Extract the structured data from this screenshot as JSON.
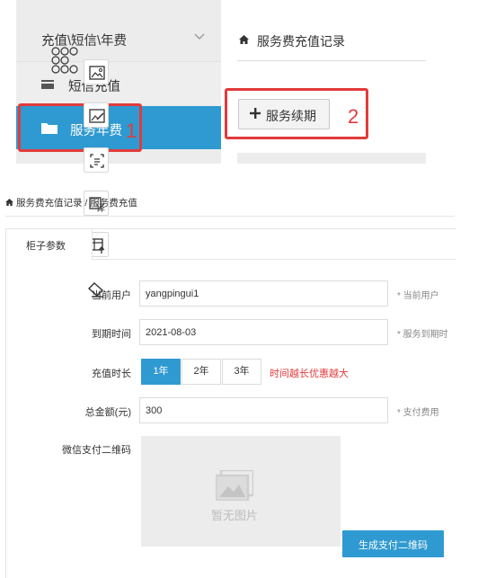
{
  "top_screenshot": {
    "sidebar": {
      "header_label": "充值\\短信\\年费",
      "items": [
        {
          "label": "短信充值",
          "visible_label": "短信充值",
          "icon": "card-icon"
        },
        {
          "label": "服务年费",
          "icon": "folder-icon",
          "active": true
        }
      ]
    },
    "right_panel": {
      "title": "服务费充值记录",
      "renew_button_label": "服务续期"
    },
    "annotations": [
      "1",
      "2"
    ],
    "toolbar_icons": [
      "image-icon",
      "image-edit-icon",
      "text-extract-icon",
      "translate-icon",
      "table-icon",
      "eraser-icon"
    ]
  },
  "breadcrumb": "服务费充值记录 / 服务费充值",
  "breadcrumb_left": "服务费充值记录",
  "breadcrumb_right": "服务费充值",
  "form": {
    "tab_label": "柜子参数",
    "user_label": "当前用户",
    "user_value": "yangpingui1",
    "user_hint": "* 当前用户",
    "expire_label": "到期时间",
    "expire_value": "2021-08-03",
    "expire_hint": "* 服务到期时",
    "duration_label": "充值时长",
    "duration_options": [
      "1年",
      "2年",
      "3年"
    ],
    "duration_selected": "1年",
    "duration_note": "时间越长优惠越大",
    "amount_label": "总金额(元)",
    "amount_value": "300",
    "amount_hint": "* 支付费用",
    "qr_label": "微信支付二维码",
    "qr_placeholder": "暂无图片",
    "generate_button": "生成支付二维码"
  },
  "colors": {
    "accent": "#2f9ad1",
    "annotation_red": "#e23b3b",
    "sidebar_bg": "#ececec"
  }
}
